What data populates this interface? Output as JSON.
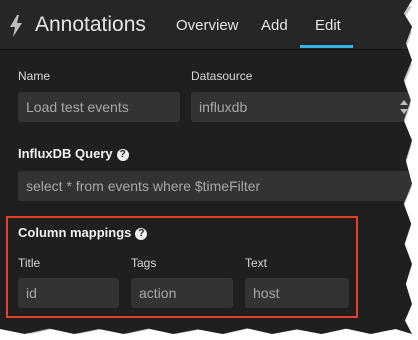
{
  "header": {
    "title": "Annotations",
    "tabs": [
      {
        "label": "Overview"
      },
      {
        "label": "Add"
      },
      {
        "label": "Edit",
        "active": true
      }
    ],
    "accent_color": "#33b5e5"
  },
  "form": {
    "name": {
      "label": "Name",
      "value": "Load test events"
    },
    "datasource": {
      "label": "Datasource",
      "value": "influxdb"
    },
    "query": {
      "label": "InfluxDB Query",
      "value": "select * from events where $timeFilter"
    },
    "column_mappings": {
      "label": "Column mappings",
      "title": {
        "label": "Title",
        "value": "id"
      },
      "tags": {
        "label": "Tags",
        "value": "action"
      },
      "text": {
        "label": "Text",
        "value": "host"
      }
    }
  },
  "icons": {
    "app": "bolt-icon",
    "help": "question-circle-icon",
    "select": "select-arrows-icon"
  },
  "highlight_color": "#e8402a"
}
